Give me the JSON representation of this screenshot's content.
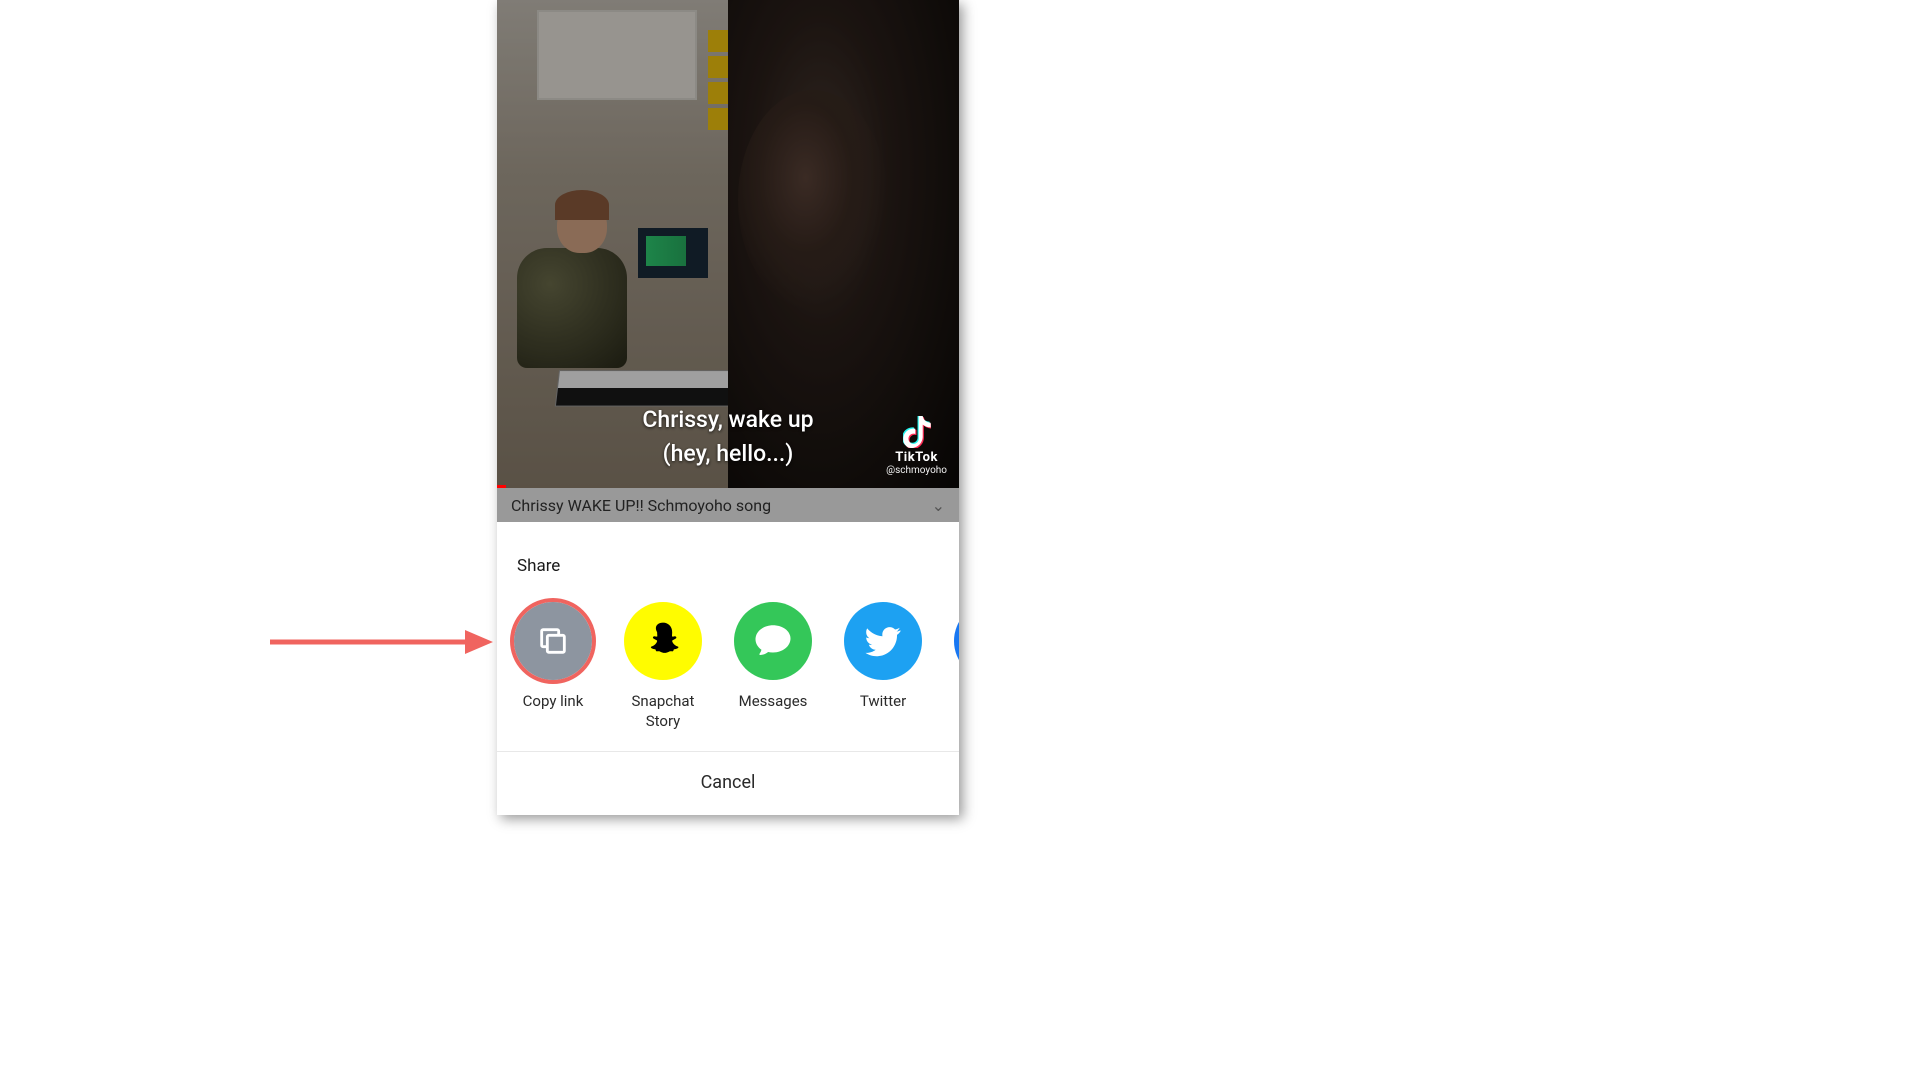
{
  "video": {
    "caption_line1": "Chrissy, wake up",
    "caption_line2": "(hey, hello...)",
    "watermark_brand": "TikTok",
    "watermark_handle": "@schmoyoho",
    "title": "Chrissy WAKE UP!! Schmoyoho song"
  },
  "share": {
    "header": "Share",
    "items": [
      {
        "label": "Copy link"
      },
      {
        "label": "Snapchat\nStory"
      },
      {
        "label": "Messages"
      },
      {
        "label": "Twitter"
      },
      {
        "label": ""
      }
    ],
    "cancel": "Cancel"
  }
}
